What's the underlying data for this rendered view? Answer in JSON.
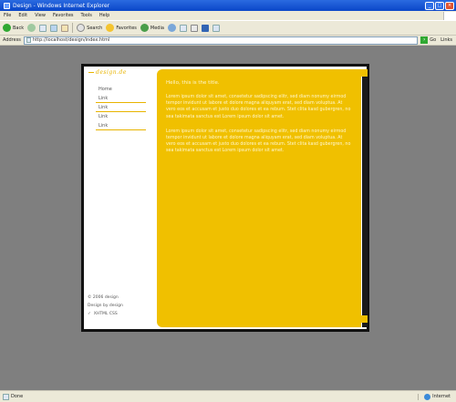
{
  "window": {
    "title": "Design - Windows Internet Explorer"
  },
  "menu": [
    "File",
    "Edit",
    "View",
    "Favorites",
    "Tools",
    "Help"
  ],
  "toolbar": {
    "back": "Back",
    "search": "Search",
    "favorites": "Favorites",
    "media": "Media"
  },
  "address": {
    "label": "Address",
    "url": "http://localhost/design/index.html",
    "go": "Go",
    "links": "Links"
  },
  "page": {
    "logo": "design.de",
    "nav": [
      "Home",
      "Link",
      "Link",
      "Link",
      "Link"
    ],
    "credits": [
      "© 2006 design",
      "Design by design",
      "XHTML  CSS"
    ],
    "greeting": "Hello, this is the title.",
    "paragraphs": [
      "Lorem ipsum dolor sit amet, consetetur sadipscing elitr, sed diam nonumy eirmod tempor invidunt ut labore et dolore magna aliquyam erat, sed diam voluptua. At vero eos et accusam et justo duo dolores et ea rebum. Stet clita kasd gubergren, no sea takimata sanctus est Lorem ipsum dolor sit amet.",
      "Lorem ipsum dolor sit amet, consetetur sadipscing elitr, sed diam nonumy eirmod tempor invidunt ut labore et dolore magna aliquyam erat, sed diam voluptua. At vero eos et accusam et justo duo dolores et ea rebum. Stet clita kasd gubergren, no sea takimata sanctus est Lorem ipsum dolor sit amet."
    ]
  },
  "status": {
    "text": "Done",
    "zone": "Internet"
  },
  "colors": {
    "accent": "#f0c000",
    "frame": "#111111",
    "background": "#7f7f7f"
  }
}
